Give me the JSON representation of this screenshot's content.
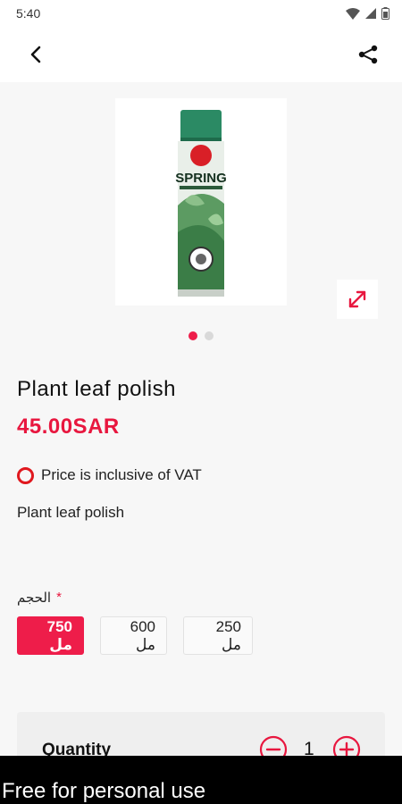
{
  "status_bar": {
    "time": "5:40"
  },
  "app_bar": {
    "back_icon": "chevron-left-icon",
    "share_icon": "share-icon"
  },
  "product": {
    "image": "spray-can-product-image",
    "image_text": "SPRING",
    "title": "Plant leaf polish",
    "price": "45.00SAR",
    "vat_note": "Price is inclusive of VAT",
    "description": "Plant leaf polish"
  },
  "carousel": {
    "count": 2,
    "active_index": 0
  },
  "variant": {
    "label": "الحجم",
    "required_mark": "*",
    "options": [
      {
        "label": "750 مل",
        "selected": true
      },
      {
        "label": "600 مل",
        "selected": false
      },
      {
        "label": "250 مل",
        "selected": false
      }
    ]
  },
  "quantity": {
    "label": "Quantity",
    "value": "1"
  },
  "watermark": "Free for personal use",
  "colors": {
    "accent": "#ee1d4a",
    "price": "#e8173f",
    "background": "#f7f7f7"
  }
}
